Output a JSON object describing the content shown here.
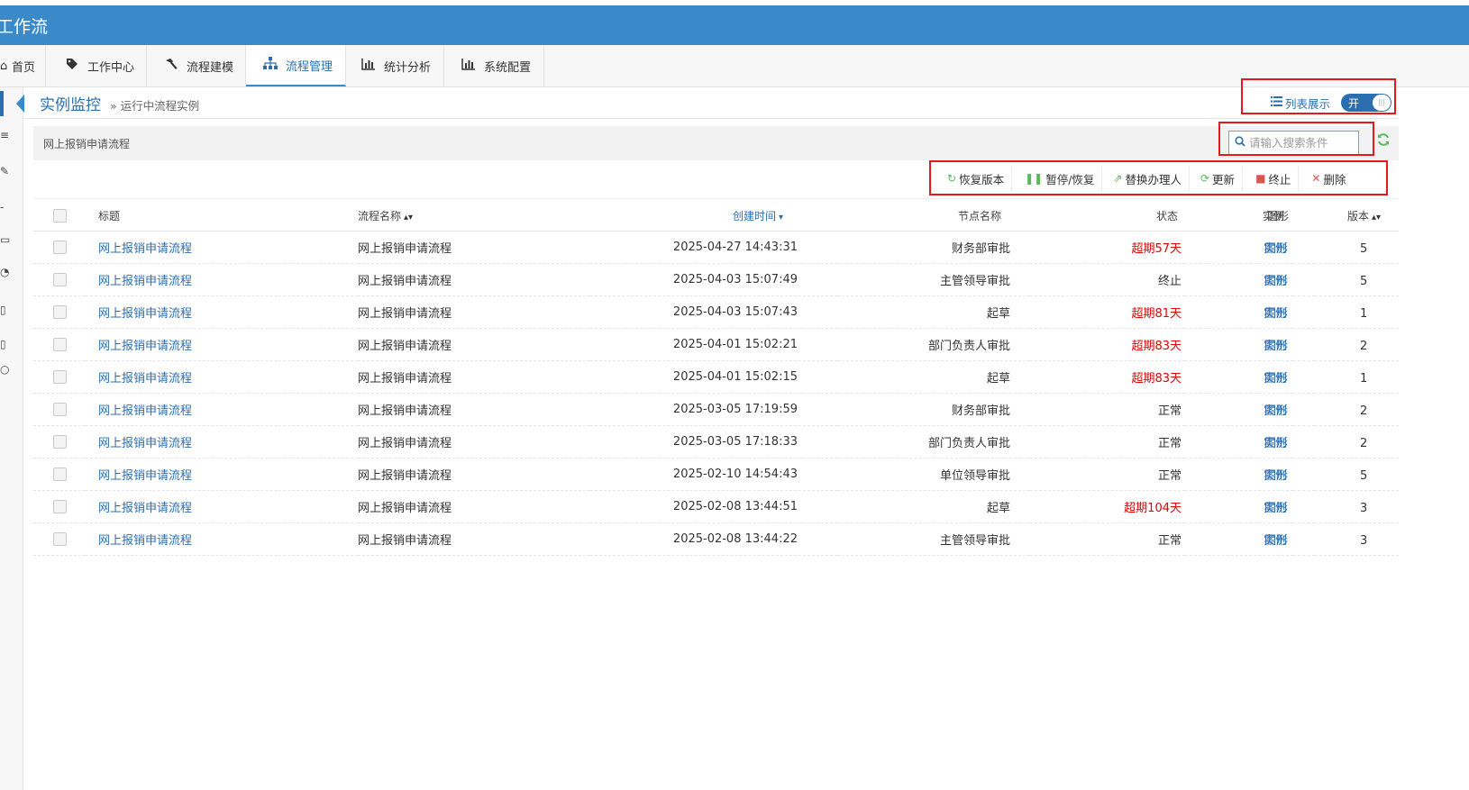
{
  "app": {
    "title": "工作流"
  },
  "nav": {
    "tabs": [
      {
        "label": "首页",
        "icon": "home-icon"
      },
      {
        "label": "工作中心",
        "icon": "tag-icon"
      },
      {
        "label": "流程建模",
        "icon": "hammer-icon"
      },
      {
        "label": "流程管理",
        "icon": "sitemap-icon",
        "active": true
      },
      {
        "label": "统计分析",
        "icon": "bar-chart-icon"
      },
      {
        "label": "系统配置",
        "icon": "bar-chart-icon"
      }
    ]
  },
  "breadcrumb": {
    "main": "实例监控",
    "sub": "» 运行中流程实例"
  },
  "view_toggle": {
    "label": "列表展示",
    "state_text": "开"
  },
  "panel": {
    "title": "网上报销申请流程"
  },
  "search": {
    "placeholder": "请输入搜索条件"
  },
  "toolbar": {
    "restore_version": "恢复版本",
    "pause_resume": "暂停/恢复",
    "replace_handler": "替换办理人",
    "update": "更新",
    "terminate": "终止",
    "delete": "删除"
  },
  "table": {
    "headers": {
      "title": "标题",
      "process_name": "流程名称",
      "created": "创建时间",
      "node": "节点名称",
      "status": "状态",
      "graph": "图形",
      "instance": "实例",
      "version": "版本"
    },
    "rows": [
      {
        "title": "网上报销申请流程",
        "process": "网上报销申请流程",
        "created": "2025-04-27 14:43:31",
        "node": "财务部审批",
        "status": "超期57天",
        "overdue": true,
        "graph": "图形",
        "instance": "实例",
        "version": "5"
      },
      {
        "title": "网上报销申请流程",
        "process": "网上报销申请流程",
        "created": "2025-04-03 15:07:49",
        "node": "主管领导审批",
        "status": "终止",
        "overdue": false,
        "graph": "图形",
        "instance": "实例",
        "version": "5"
      },
      {
        "title": "网上报销申请流程",
        "process": "网上报销申请流程",
        "created": "2025-04-03 15:07:43",
        "node": "起草",
        "status": "超期81天",
        "overdue": true,
        "graph": "图形",
        "instance": "实例",
        "version": "1"
      },
      {
        "title": "网上报销申请流程",
        "process": "网上报销申请流程",
        "created": "2025-04-01 15:02:21",
        "node": "部门负责人审批",
        "status": "超期83天",
        "overdue": true,
        "graph": "图形",
        "instance": "实例",
        "version": "2"
      },
      {
        "title": "网上报销申请流程",
        "process": "网上报销申请流程",
        "created": "2025-04-01 15:02:15",
        "node": "起草",
        "status": "超期83天",
        "overdue": true,
        "graph": "图形",
        "instance": "实例",
        "version": "1"
      },
      {
        "title": "网上报销申请流程",
        "process": "网上报销申请流程",
        "created": "2025-03-05 17:19:59",
        "node": "财务部审批",
        "status": "正常",
        "overdue": false,
        "graph": "图形",
        "instance": "实例",
        "version": "2"
      },
      {
        "title": "网上报销申请流程",
        "process": "网上报销申请流程",
        "created": "2025-03-05 17:18:33",
        "node": "部门负责人审批",
        "status": "正常",
        "overdue": false,
        "graph": "图形",
        "instance": "实例",
        "version": "2"
      },
      {
        "title": "网上报销申请流程",
        "process": "网上报销申请流程",
        "created": "2025-02-10 14:54:43",
        "node": "单位领导审批",
        "status": "正常",
        "overdue": false,
        "graph": "图形",
        "instance": "实例",
        "version": "5"
      },
      {
        "title": "网上报销申请流程",
        "process": "网上报销申请流程",
        "created": "2025-02-08 13:44:51",
        "node": "起草",
        "status": "超期104天",
        "overdue": true,
        "graph": "图形",
        "instance": "实例",
        "version": "3"
      },
      {
        "title": "网上报销申请流程",
        "process": "网上报销申请流程",
        "created": "2025-02-08 13:44:22",
        "node": "主管领导审批",
        "status": "正常",
        "overdue": false,
        "graph": "图形",
        "instance": "实例",
        "version": "3"
      }
    ]
  },
  "colors": {
    "header_blue": "#3a89c9",
    "link_blue": "#2c6fb0",
    "overdue_red": "#e00000",
    "highlight_red": "#e5191c"
  }
}
